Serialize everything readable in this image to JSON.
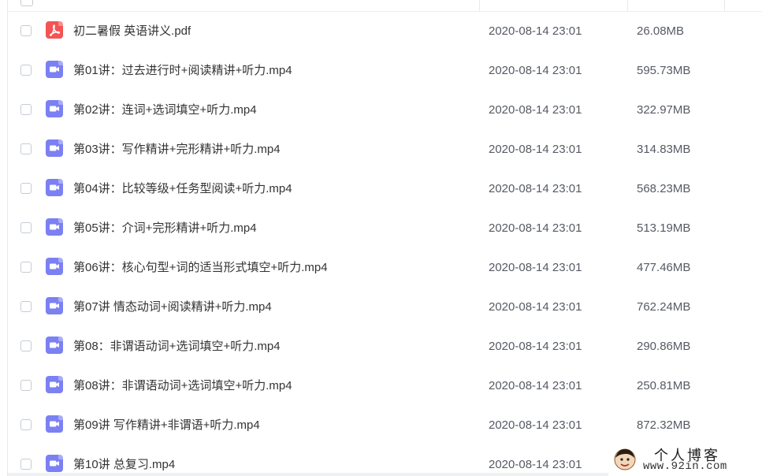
{
  "files": [
    {
      "type": "pdf",
      "name": "初二暑假 英语讲义.pdf",
      "date": "2020-08-14 23:01",
      "size": "26.08MB"
    },
    {
      "type": "video",
      "name": "第01讲：过去进行时+阅读精讲+听力.mp4",
      "date": "2020-08-14 23:01",
      "size": "595.73MB"
    },
    {
      "type": "video",
      "name": "第02讲：连词+选词填空+听力.mp4",
      "date": "2020-08-14 23:01",
      "size": "322.97MB"
    },
    {
      "type": "video",
      "name": "第03讲：写作精讲+完形精讲+听力.mp4",
      "date": "2020-08-14 23:01",
      "size": "314.83MB"
    },
    {
      "type": "video",
      "name": "第04讲：比较等级+任务型阅读+听力.mp4",
      "date": "2020-08-14 23:01",
      "size": "568.23MB"
    },
    {
      "type": "video",
      "name": "第05讲：介词+完形精讲+听力.mp4",
      "date": "2020-08-14 23:01",
      "size": "513.19MB"
    },
    {
      "type": "video",
      "name": "第06讲：核心句型+词的适当形式填空+听力.mp4",
      "date": "2020-08-14 23:01",
      "size": "477.46MB"
    },
    {
      "type": "video",
      "name": "第07讲 情态动词+阅读精讲+听力.mp4",
      "date": "2020-08-14 23:01",
      "size": "762.24MB"
    },
    {
      "type": "video",
      "name": "第08：非谓语动词+选词填空+听力.mp4",
      "date": "2020-08-14 23:01",
      "size": "290.86MB"
    },
    {
      "type": "video",
      "name": "第08讲：非谓语动词+选词填空+听力.mp4",
      "date": "2020-08-14 23:01",
      "size": "250.81MB"
    },
    {
      "type": "video",
      "name": "第09讲 写作精讲+非谓语+听力.mp4",
      "date": "2020-08-14 23:01",
      "size": "872.32MB"
    },
    {
      "type": "video",
      "name": "第10讲 总复习.mp4",
      "date": "2020-08-14 23:01",
      "size": ""
    }
  ],
  "colors": {
    "pdf_icon": "#f35454",
    "video_icon": "#7b80f3",
    "text": "#333333",
    "meta_text": "#555a63"
  },
  "icons": {
    "pdf": "pdf-file-icon",
    "video": "video-file-icon"
  },
  "watermark": {
    "title": "个人博客",
    "url": "www.92in.com"
  }
}
